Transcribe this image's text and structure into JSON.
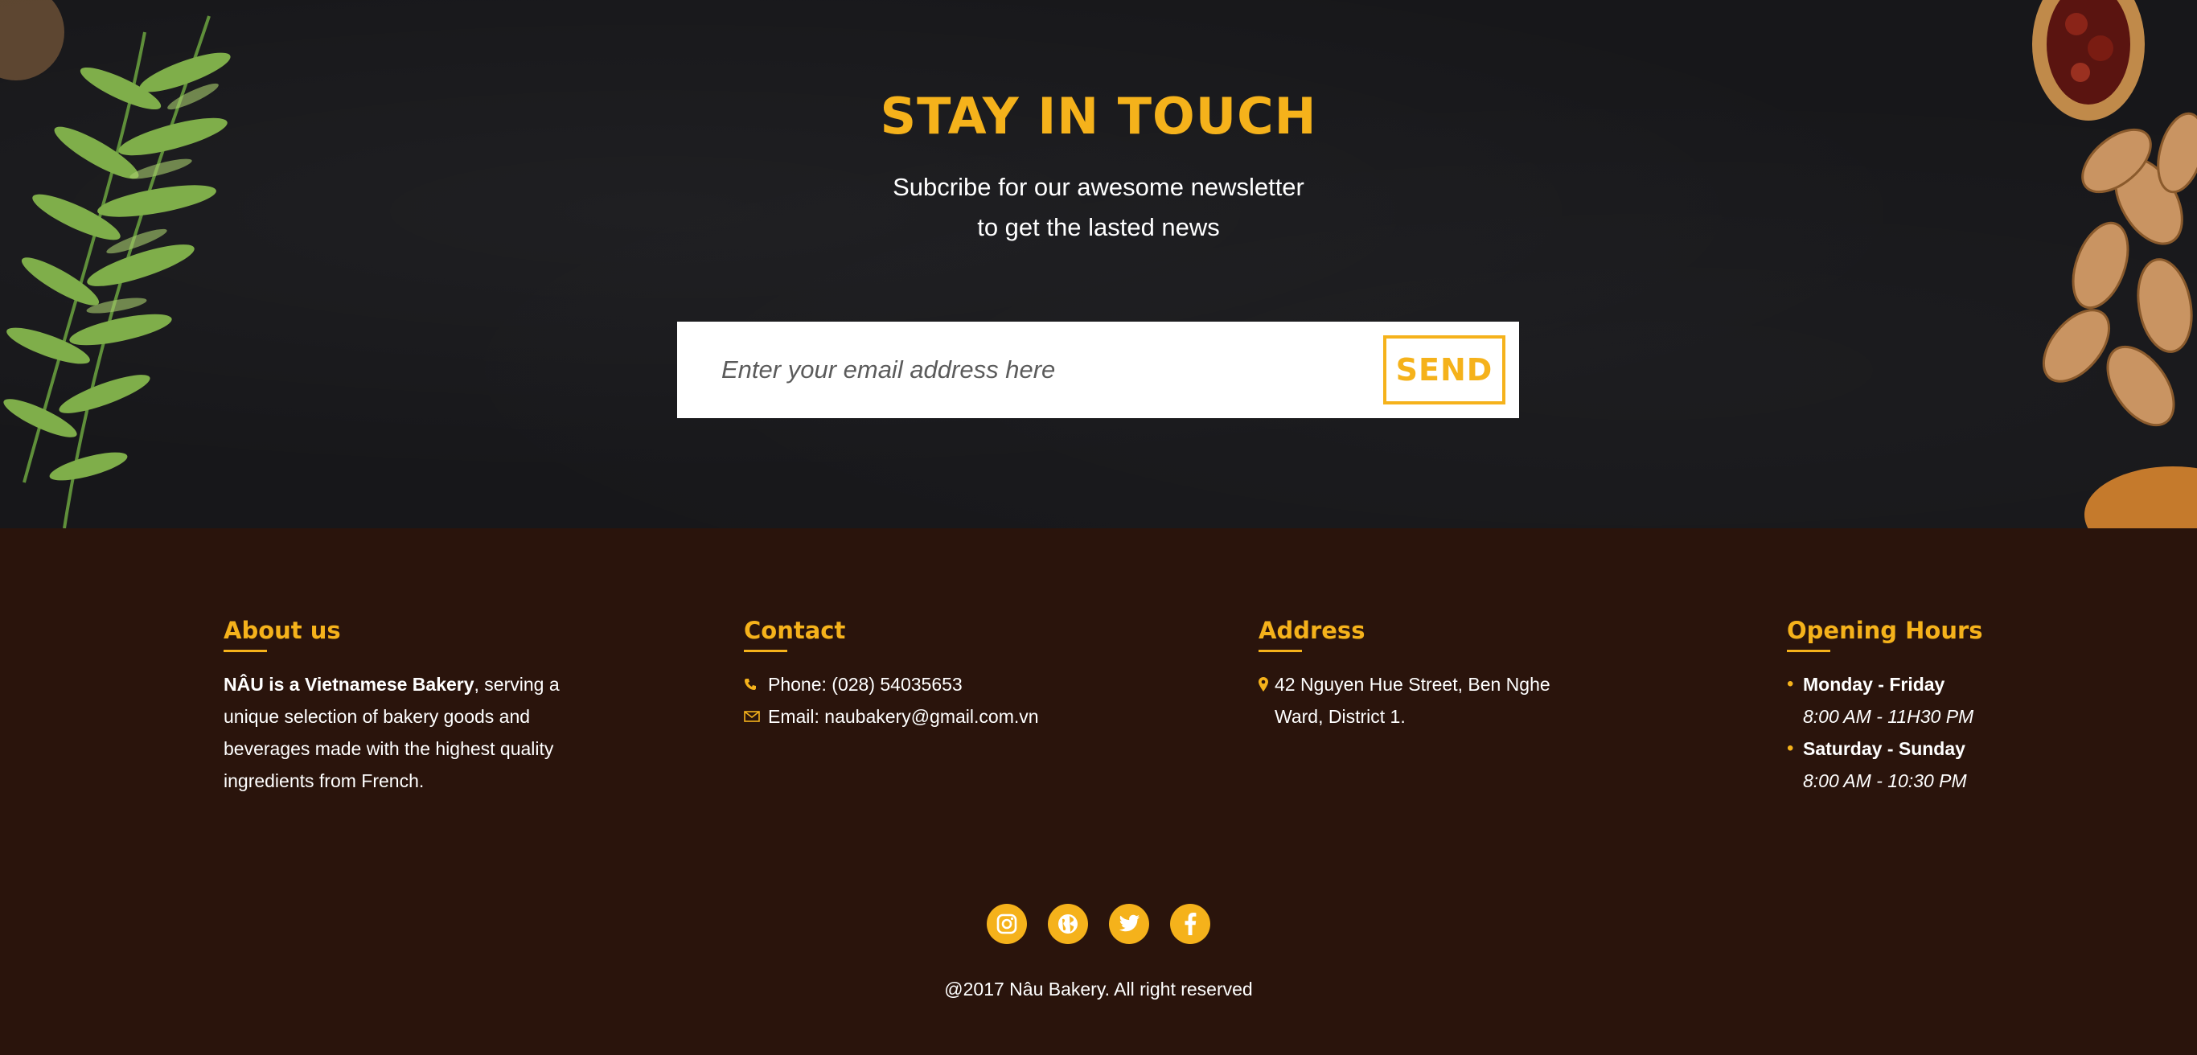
{
  "newsletter": {
    "title": "STAY IN TOUCH",
    "subtitle_line1": "Subcribe for our awesome newsletter",
    "subtitle_line2": "to get the lasted news",
    "email_placeholder": "Enter your email address here",
    "send_label": "SEND"
  },
  "footer": {
    "about": {
      "title": "About us",
      "brand": "NÂU is a Vietnamese Bakery",
      "text": ", serving a unique selection of bakery goods and beverages made with the highest quality ingredients from French."
    },
    "contact": {
      "title": "Contact",
      "phone": "Phone: (028) 54035653",
      "email": "Email: naubakery@gmail.com.vn"
    },
    "address": {
      "title": "Address",
      "line1": "42 Nguyen Hue Street, Ben Nghe",
      "line2": "Ward, District 1."
    },
    "hours": {
      "title": "Opening Hours",
      "items": [
        {
          "days": "Monday - Friday",
          "time": "8:00 AM - 11H30 PM"
        },
        {
          "days": "Saturday - Sunday",
          "time": "8:00 AM - 10:30 PM"
        }
      ]
    },
    "socials": [
      "instagram-icon",
      "globe-icon",
      "twitter-icon",
      "facebook-icon"
    ],
    "copyright": "@2017 Nâu Bakery. All right reserved"
  },
  "colors": {
    "accent": "#f5b21b",
    "hero_bg": "#17171a",
    "footer_bg": "#2a140c"
  }
}
